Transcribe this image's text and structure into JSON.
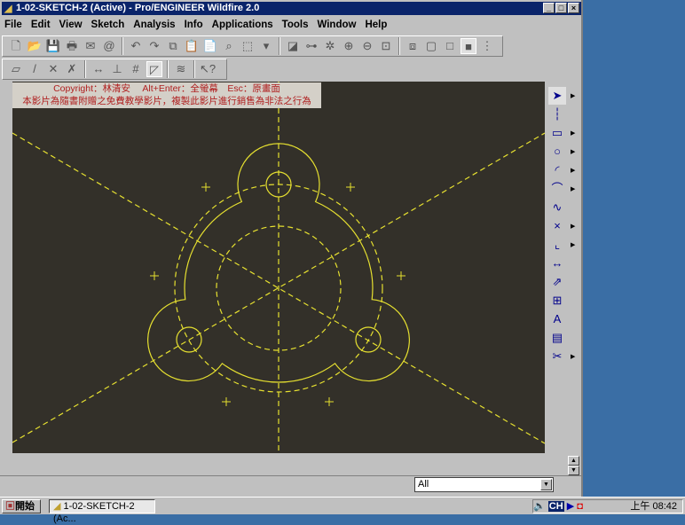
{
  "window": {
    "title": "1-02-SKETCH-2 (Active) - Pro/ENGINEER Wildfire 2.0",
    "min": "_",
    "max": "□",
    "close": "×"
  },
  "menu": [
    "File",
    "Edit",
    "View",
    "Sketch",
    "Analysis",
    "Info",
    "Applications",
    "Tools",
    "Window",
    "Help"
  ],
  "toolbar1": [
    "new-icon",
    "open-icon",
    "save-icon",
    "print-icon",
    "send-icon",
    "email-icon",
    "|",
    "undo-icon",
    "redo-icon",
    "copy-icon",
    "paste-icon",
    "paste-special-icon",
    "find-icon",
    "select-box-icon",
    "dropdown-icon",
    "|",
    "sketch-setup-icon",
    "datum-display-icon",
    "spin-center-icon",
    "zoom-in-icon",
    "zoom-out-icon",
    "refit-icon",
    "|",
    "wireframe-icon",
    "hidden-line-icon",
    "no-hidden-icon",
    "shading-icon",
    "model-tree-icon"
  ],
  "toolbar2": [
    "toggle-dim-icon",
    "toggle-constraint-icon",
    "toggle-grid-icon",
    "toggle-vertex-icon",
    "|",
    "dim-display-icon",
    "weak-dim-icon",
    "grid-icon",
    "vertex-icon",
    "|",
    "intent-manager-icon",
    "|",
    "whats-this-icon"
  ],
  "notice": {
    "line1": "Copyright：林清安　 Alt+Enter：全螢幕　Esc：原畫面",
    "line2": "本影片為隨書附贈之免費教學影片，複製此影片進行銷售為非法之行為"
  },
  "sketch_tools": [
    "select-icon",
    "centerline-icon",
    "rectangle-icon",
    "circle-icon",
    "arc-icon",
    "fillet-icon",
    "spline-icon",
    "point-icon",
    "coordinate-system-icon",
    "dimension-icon",
    "modify-icon",
    "constraints-icon",
    "text-icon",
    "palette-icon",
    "trim-icon",
    "mirror-icon"
  ],
  "filter": {
    "value": "All"
  },
  "taskbar": {
    "start": "開始",
    "task": "1-02-SKETCH-2 (Ac...",
    "clock": "上午 08:42",
    "ime": "CH"
  },
  "colors": {
    "canvas": "#333029",
    "sketch": "#e6e030",
    "title_bar": "#0a246a",
    "notice_text": "#b02020"
  }
}
